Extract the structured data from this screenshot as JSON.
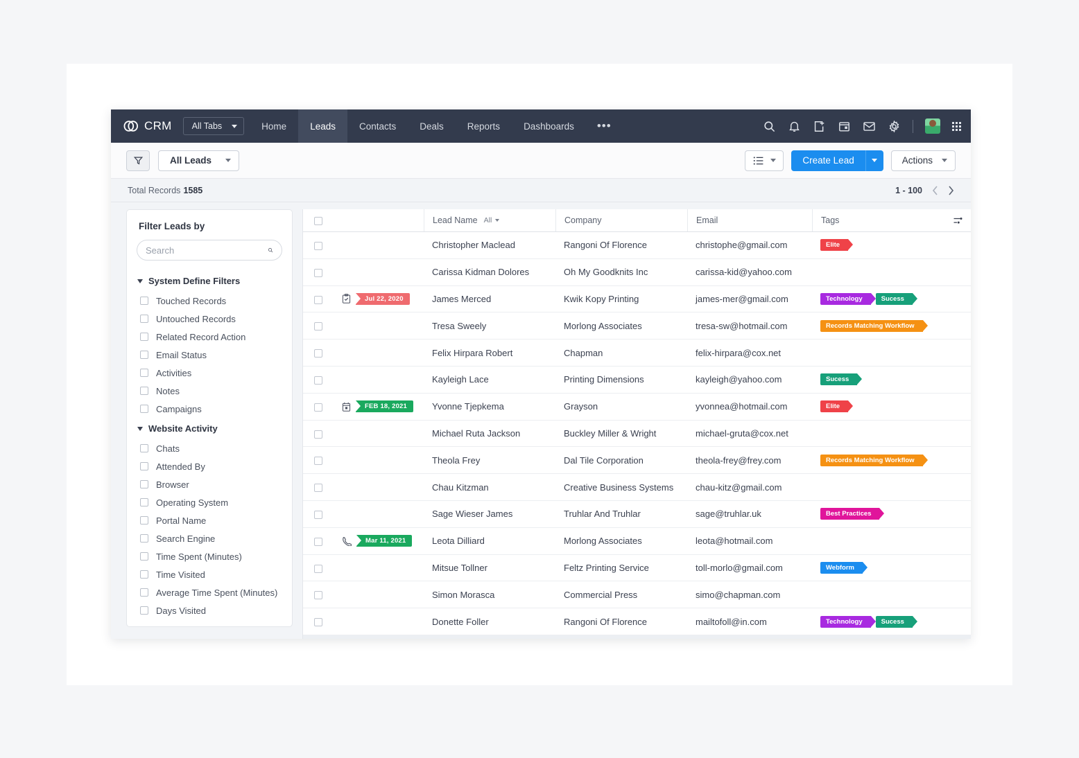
{
  "nav": {
    "brand": "CRM",
    "all_tabs": "All Tabs",
    "links": [
      {
        "label": "Home",
        "active": false
      },
      {
        "label": "Leads",
        "active": true
      },
      {
        "label": "Contacts",
        "active": false
      },
      {
        "label": "Deals",
        "active": false
      },
      {
        "label": "Reports",
        "active": false
      },
      {
        "label": "Dashboards",
        "active": false
      }
    ],
    "more": "•••",
    "icons": [
      "search-icon",
      "bell-icon",
      "add-note-icon",
      "calendar-icon",
      "mail-icon",
      "gear-icon",
      "avatar",
      "apps-grid-icon"
    ]
  },
  "toolbar": {
    "filter_icon": "filter-icon",
    "view_name": "All Leads",
    "list_view_icon": "list-view-icon",
    "create_label": "Create Lead",
    "actions_label": "Actions"
  },
  "records_bar": {
    "total_label": "Total Records",
    "total_count": "1585",
    "page_range": "1 - 100"
  },
  "sidebar": {
    "title": "Filter Leads by",
    "search_placeholder": "Search",
    "search_value": "",
    "groups": [
      {
        "label": "System Define Filters",
        "items": [
          "Touched Records",
          "Untouched Records",
          "Related Record Action",
          "Email Status",
          "Activities",
          "Notes",
          "Campaigns"
        ]
      },
      {
        "label": "Website Activity",
        "items": [
          "Chats",
          "Attended By",
          "Browser",
          "Operating System",
          "Portal Name",
          "Search Engine",
          "Time Spent (Minutes)",
          "Time Visited",
          "Average Time Spent (Minutes)",
          "Days Visited"
        ]
      }
    ]
  },
  "table": {
    "columns": {
      "lead_name": "Lead Name",
      "name_filter": "All",
      "company": "Company",
      "email": "Email",
      "tags": "Tags",
      "settings_icon": "column-settings-icon"
    },
    "tag_colors": {
      "Elite": "#ef4248",
      "Technology": "#a82ae0",
      "Sucess": "#17a07a",
      "Records Matching Workflow": "#f59113",
      "Best Practices": "#e0159b",
      "Webform": "#1b8def"
    },
    "rows": [
      {
        "activity": null,
        "name": "Christopher Maclead",
        "company": "Rangoni Of Florence",
        "email": "christophe@gmail.com",
        "tags": [
          "Elite"
        ]
      },
      {
        "activity": null,
        "name": "Carissa Kidman Dolores",
        "company": "Oh My Goodknits Inc",
        "email": "carissa-kid@yahoo.com",
        "tags": []
      },
      {
        "activity": {
          "icon": "task-icon",
          "date": "Jul 22, 2020",
          "color": "#ef6b6f"
        },
        "name": "James Merced",
        "company": "Kwik Kopy Printing",
        "email": "james-mer@gmail.com",
        "tags": [
          "Technology",
          "Sucess"
        ]
      },
      {
        "activity": null,
        "name": "Tresa Sweely",
        "company": "Morlong Associates",
        "email": "tresa-sw@hotmail.com",
        "tags": [
          "Records Matching Workflow"
        ]
      },
      {
        "activity": null,
        "name": "Felix Hirpara Robert",
        "company": "Chapman",
        "email": "felix-hirpara@cox.net",
        "tags": []
      },
      {
        "activity": null,
        "name": "Kayleigh Lace",
        "company": "Printing Dimensions",
        "email": "kayleigh@yahoo.com",
        "tags": [
          "Sucess"
        ]
      },
      {
        "activity": {
          "icon": "event-icon",
          "date": "FEB 18, 2021",
          "color": "#1aa95e"
        },
        "name": "Yvonne Tjepkema",
        "company": "Grayson",
        "email": "yvonnea@hotmail.com",
        "tags": [
          "Elite"
        ]
      },
      {
        "activity": null,
        "name": "Michael Ruta Jackson",
        "company": "Buckley Miller & Wright",
        "email": "michael-gruta@cox.net",
        "tags": []
      },
      {
        "activity": null,
        "name": "Theola Frey",
        "company": "Dal Tile Corporation",
        "email": "theola-frey@frey.com",
        "tags": [
          "Records Matching Workflow"
        ]
      },
      {
        "activity": null,
        "name": "Chau Kitzman",
        "company": "Creative Business Systems",
        "email": "chau-kitz@gmail.com",
        "tags": []
      },
      {
        "activity": null,
        "name": "Sage Wieser James",
        "company": "Truhlar And Truhlar",
        "email": "sage@truhlar.uk",
        "tags": [
          "Best Practices"
        ]
      },
      {
        "activity": {
          "icon": "phone-icon",
          "date": "Mar 11, 2021",
          "color": "#1aa95e"
        },
        "name": "Leota Dilliard",
        "company": "Morlong Associates",
        "email": "leota@hotmail.com",
        "tags": []
      },
      {
        "activity": null,
        "name": "Mitsue Tollner",
        "company": "Feltz Printing Service",
        "email": "toll-morlo@gmail.com",
        "tags": [
          "Webform"
        ]
      },
      {
        "activity": null,
        "name": "Simon Morasca",
        "company": "Commercial Press",
        "email": "simo@chapman.com",
        "tags": []
      },
      {
        "activity": null,
        "name": "Donette Foller",
        "company": "Rangoni Of Florence",
        "email": "mailtofoll@in.com",
        "tags": [
          "Technology",
          "Sucess"
        ]
      }
    ]
  }
}
